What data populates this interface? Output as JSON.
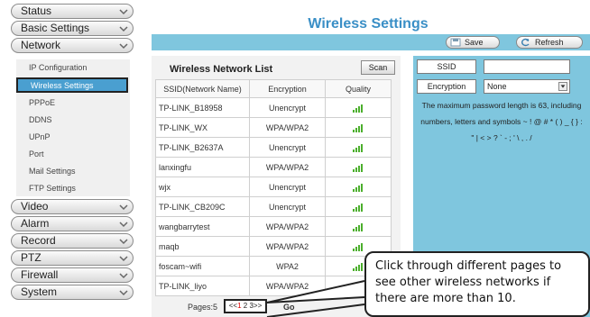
{
  "sidebar": {
    "menus": [
      {
        "label": "Status"
      },
      {
        "label": "Basic Settings"
      },
      {
        "label": "Network"
      },
      {
        "label": "Video"
      },
      {
        "label": "Alarm"
      },
      {
        "label": "Record"
      },
      {
        "label": "PTZ"
      },
      {
        "label": "Firewall"
      },
      {
        "label": "System"
      }
    ],
    "network_items": [
      {
        "label": "IP Configuration"
      },
      {
        "label": "Wireless Settings"
      },
      {
        "label": "PPPoE"
      },
      {
        "label": "DDNS"
      },
      {
        "label": "UPnP"
      },
      {
        "label": "Port"
      },
      {
        "label": "Mail Settings"
      },
      {
        "label": "FTP Settings"
      }
    ]
  },
  "page": {
    "title": "Wireless Settings",
    "save_label": "Save",
    "refresh_label": "Refresh"
  },
  "list": {
    "title": "Wireless Network List",
    "scan_label": "Scan",
    "columns": [
      "SSID(Network Name)",
      "Encryption",
      "Quality"
    ],
    "rows": [
      {
        "ssid": "TP-LINK_B18958",
        "encryption": "Unencrypt"
      },
      {
        "ssid": "TP-LINK_WX",
        "encryption": "WPA/WPA2"
      },
      {
        "ssid": "TP-LINK_B2637A",
        "encryption": "Unencrypt"
      },
      {
        "ssid": "lanxingfu",
        "encryption": "WPA/WPA2"
      },
      {
        "ssid": "wjx",
        "encryption": "Unencrypt"
      },
      {
        "ssid": "TP-LINK_CB209C",
        "encryption": "Unencrypt"
      },
      {
        "ssid": "wangbarrytest",
        "encryption": "WPA/WPA2"
      },
      {
        "ssid": "maqb",
        "encryption": "WPA/WPA2"
      },
      {
        "ssid": "foscam~wifi",
        "encryption": "WPA2"
      },
      {
        "ssid": "TP-LINK_liyo",
        "encryption": "WPA/WPA2"
      }
    ],
    "pages_label": "Pages:5",
    "pager_prev": "<<",
    "pager_current": "1",
    "pager_rest": " 2 3>>",
    "go_label": "Go"
  },
  "config": {
    "ssid_label": "SSID",
    "ssid_value": "",
    "encryption_label": "Encryption",
    "encryption_value": "None",
    "help_line1": "The maximum password length is 63, including",
    "help_line2": "numbers, letters and symbols ~ ! @ # * ( ) _ { } :",
    "help_line3": "\" | < > ? ` - ; ' \\ , . /"
  },
  "callout": {
    "text": "Click through different pages to see other wireless networks if there are more than 10."
  },
  "colors": {
    "accent": "#7fc6de",
    "title": "#3a8fc6",
    "active_item": "#4a9fd0",
    "signal": "#4caf2d"
  }
}
